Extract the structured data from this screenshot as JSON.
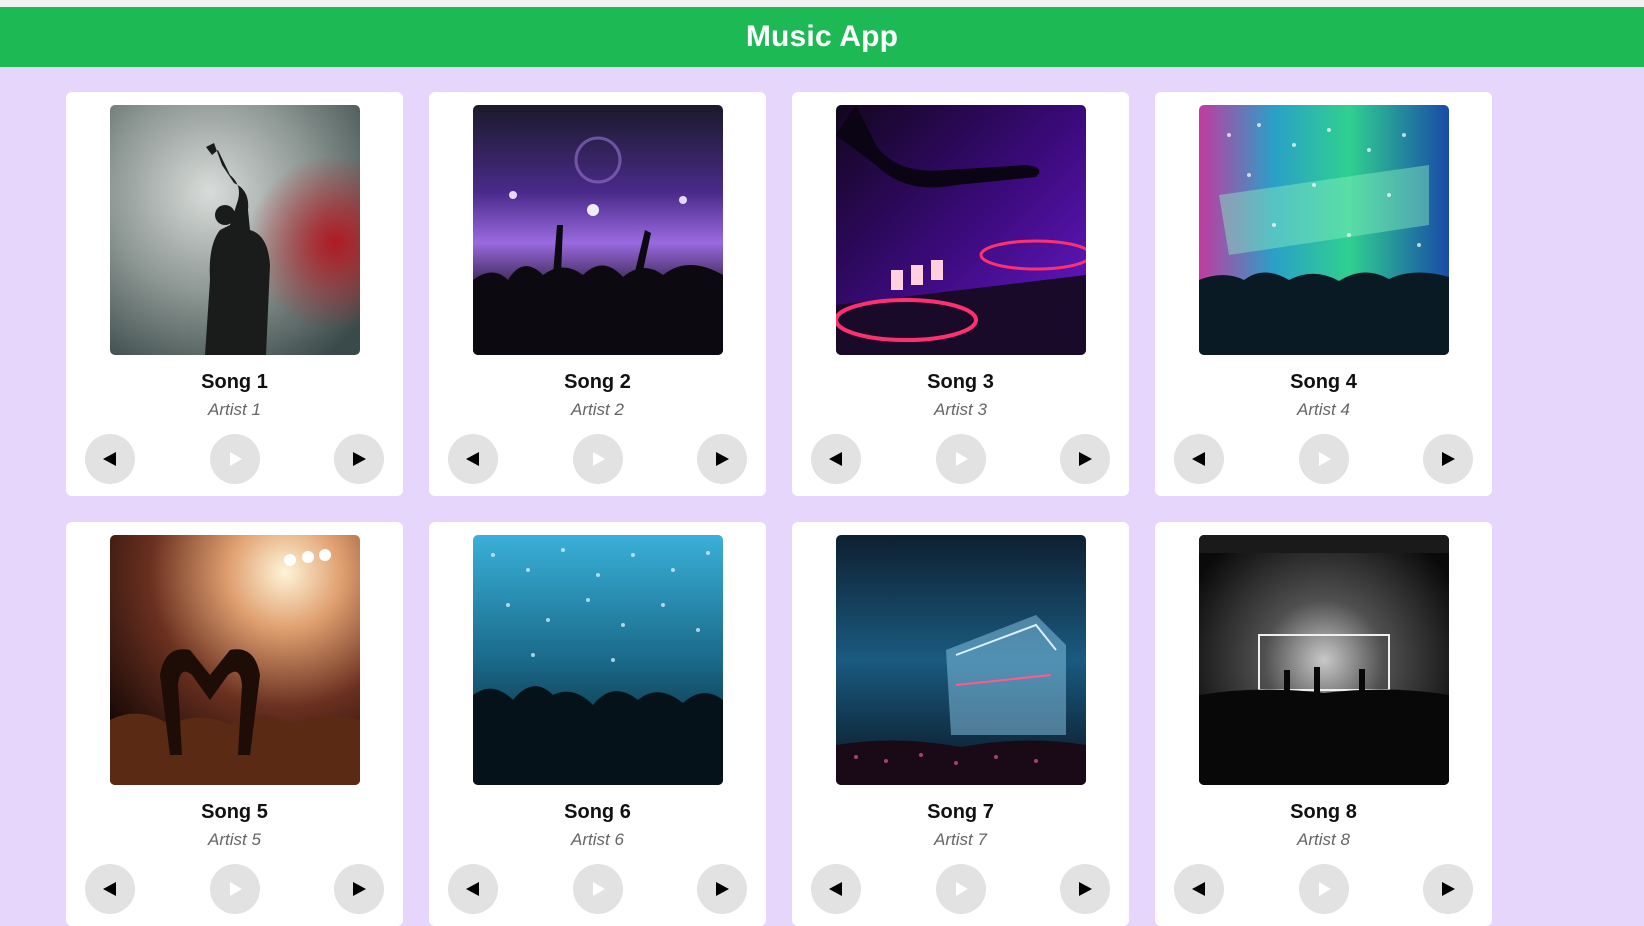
{
  "app": {
    "title": "Music App",
    "colors": {
      "header": "#1db954",
      "background": "#e7d6fb",
      "card": "#ffffff",
      "button": "#e2e2e2",
      "play_icon": "#ffffff",
      "nav_icon": "#000000"
    }
  },
  "controls": {
    "prev_icon": "triangle-left-icon",
    "play_icon": "play-icon",
    "next_icon": "triangle-right-icon"
  },
  "songs": [
    {
      "title": "Song 1",
      "artist": "Artist 1",
      "cover": "singer-with-smoke"
    },
    {
      "title": "Song 2",
      "artist": "Artist 2",
      "cover": "purple-concert-crowd"
    },
    {
      "title": "Song 3",
      "artist": "Artist 3",
      "cover": "dj-turntable"
    },
    {
      "title": "Song 4",
      "artist": "Artist 4",
      "cover": "confetti-light-show"
    },
    {
      "title": "Song 5",
      "artist": "Artist 5",
      "cover": "heart-hands-crowd"
    },
    {
      "title": "Song 6",
      "artist": "Artist 6",
      "cover": "blue-confetti-crowd"
    },
    {
      "title": "Song 7",
      "artist": "Artist 7",
      "cover": "outdoor-stage-night"
    },
    {
      "title": "Song 8",
      "artist": "Artist 8",
      "cover": "monochrome-stage"
    }
  ]
}
